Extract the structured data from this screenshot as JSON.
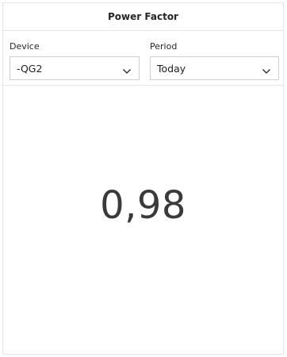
{
  "widget": {
    "title": "Power Factor"
  },
  "filters": {
    "device": {
      "label": "Device",
      "selected": "-QG2"
    },
    "period": {
      "label": "Period",
      "selected": "Today"
    }
  },
  "metric": {
    "value": "0,98"
  },
  "icons": {
    "dropdown": "chevron-down-icon"
  }
}
